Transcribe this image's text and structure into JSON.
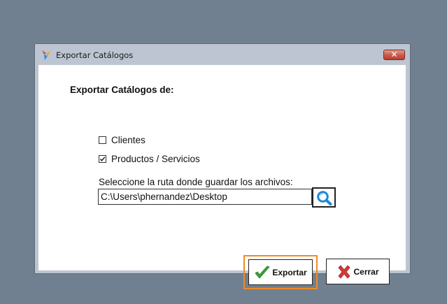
{
  "window": {
    "title": "Exportar Catálogos",
    "close_glyph": "✕"
  },
  "form": {
    "heading": "Exportar Catálogos de:",
    "options": [
      {
        "label": "Clientes",
        "checked": false
      },
      {
        "label": "Productos / Servicios",
        "checked": true
      }
    ],
    "path_label": "Seleccione la ruta donde guardar los archivos:",
    "path_value": "C:\\Users\\phernandez\\Desktop"
  },
  "buttons": {
    "export_label": "Exportar",
    "close_label": "Cerrar"
  },
  "icons": {
    "app": "app-logo-icon",
    "browse": "search-icon",
    "export": "checkmark-icon",
    "close": "x-mark-icon"
  },
  "colors": {
    "desktop": "#708090",
    "frame": "#bcc5d1",
    "focus_border": "#f08a24",
    "search_blue": "#1e88d8",
    "check_green": "#3aa335",
    "close_red": "#d23a3a"
  }
}
